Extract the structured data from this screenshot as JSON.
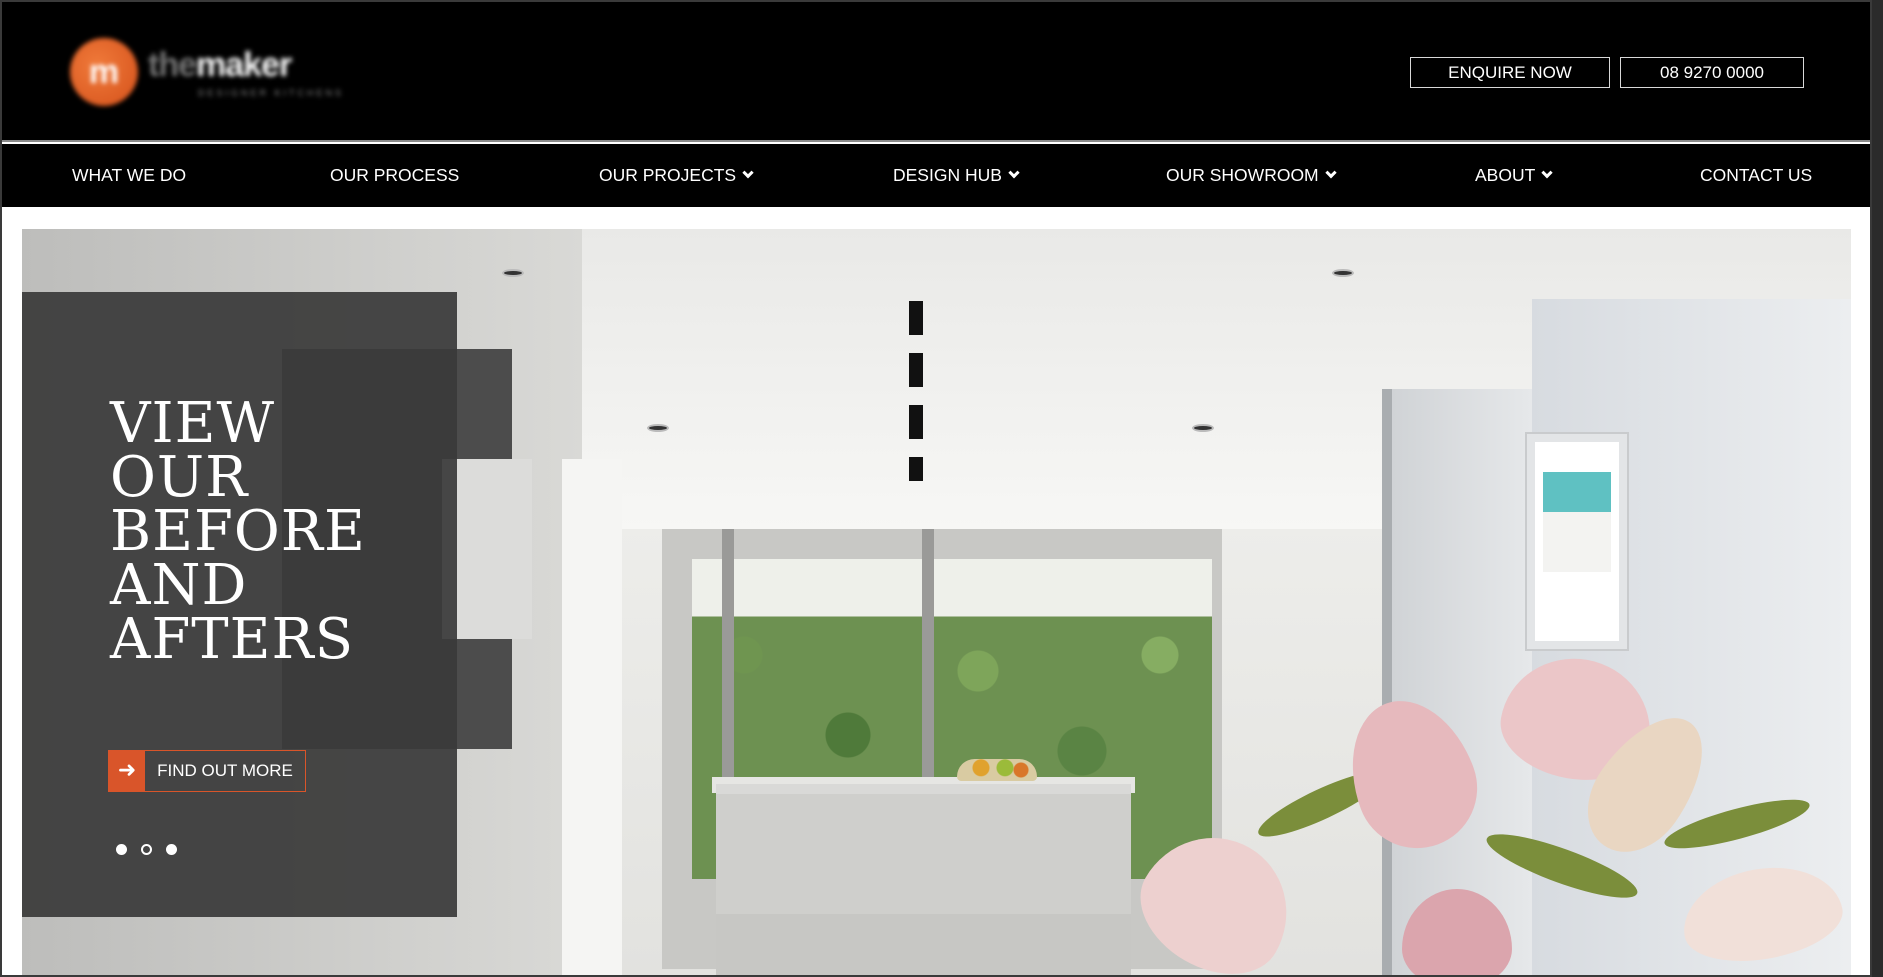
{
  "header": {
    "logo_name": "themaker",
    "logo_highlight": "the",
    "logo_rest": "maker",
    "logo_mark": "m",
    "logo_tagline": "DESIGNER KITCHENS",
    "enquire_label": "ENQUIRE NOW",
    "phone_label": "08 9270 0000"
  },
  "nav": {
    "items": [
      {
        "label": "WHAT WE DO",
        "dropdown": false
      },
      {
        "label": "OUR PROCESS",
        "dropdown": false
      },
      {
        "label": "OUR PROJECTS",
        "dropdown": true
      },
      {
        "label": "DESIGN HUB",
        "dropdown": true
      },
      {
        "label": "OUR SHOWROOM",
        "dropdown": true
      },
      {
        "label": "ABOUT",
        "dropdown": true
      },
      {
        "label": "CONTACT US",
        "dropdown": false
      }
    ]
  },
  "hero": {
    "headline_lines": [
      "VIEW",
      "OUR",
      "BEFORE",
      "AND",
      "AFTERS"
    ],
    "cta_label": "FIND OUT MORE",
    "cta_icon": "arrow-right-icon",
    "slides_total": 3,
    "slide_active": 2
  },
  "colors": {
    "accent": "#d9552a",
    "header_bg": "#000000",
    "overlay_bg": "#3a3a3a"
  }
}
